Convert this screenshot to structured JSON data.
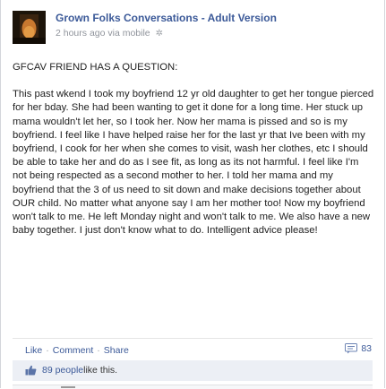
{
  "post": {
    "author": "Grown Folks Conversations - Adult Version",
    "timestamp": "2 hours ago via mobile",
    "privacy_icon": "gear-icon",
    "question_line": "GFCAV FRIEND HAS A QUESTION:",
    "body": "This past wkend I took my boyfriend 12 yr old daughter to get her tongue pierced for her bday. She had been wanting to get it done for a long time. Her stuck up mama wouldn't let her, so I took her. Now her mama is pissed and so is my boyfriend. I feel like I have helped raise her for the last yr that Ive been with my boyfriend, I cook for her when she comes to visit, wash her clothes, etc I should be able to take her and do as I see fit, as long as its not harmful. I feel like I'm not being respected as a second mother to her. I told her mama and my boyfriend that the 3 of us need to sit down and make decisions together about OUR child. No matter what anyone say I am her mother too! Now my boyfriend won't talk to me. He left Monday night and won't talk to me. We also have a new baby together. I just don't know what to do. Intelligent advice please!"
  },
  "actions": {
    "like": "Like",
    "comment": "Comment",
    "share": "Share",
    "separator": "·",
    "comment_count": "83"
  },
  "likes": {
    "count_text": "89 people",
    "suffix": " like this."
  },
  "colors": {
    "link": "#3b5998",
    "likes_bar": "#eceff5"
  }
}
